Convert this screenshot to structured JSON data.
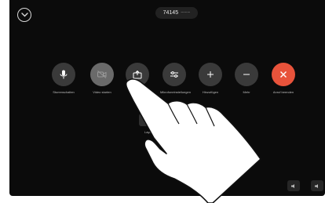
{
  "meeting": {
    "number": "74145",
    "suffix": "~~~"
  },
  "controls": [
    {
      "key": "mute",
      "label": "Stummschalten",
      "icon": "microphone-icon",
      "state": "normal"
    },
    {
      "key": "video",
      "label": "Video starten",
      "icon": "video-off-icon",
      "state": "active"
    },
    {
      "key": "share",
      "label": "",
      "icon": "share-screen-icon",
      "state": "normal"
    },
    {
      "key": "settings",
      "label": "Mikrofoneinstellungen",
      "icon": "sliders-icon",
      "state": "normal"
    },
    {
      "key": "add",
      "label": "Hinzufügen",
      "icon": "plus-icon",
      "state": "normal"
    },
    {
      "key": "more",
      "label": "Mehr",
      "icon": "more-icon",
      "state": "normal"
    },
    {
      "key": "end",
      "label": "Anruf beenden",
      "icon": "close-icon",
      "state": "end"
    }
  ],
  "sub_control": {
    "label": "Layout",
    "icon": "layout-icon"
  },
  "colors": {
    "background": "#0b0b0b",
    "button": "#3a3a3a",
    "button_active": "#6a6a6a",
    "end_call": "#e8533b",
    "hand": "#ffffff"
  }
}
